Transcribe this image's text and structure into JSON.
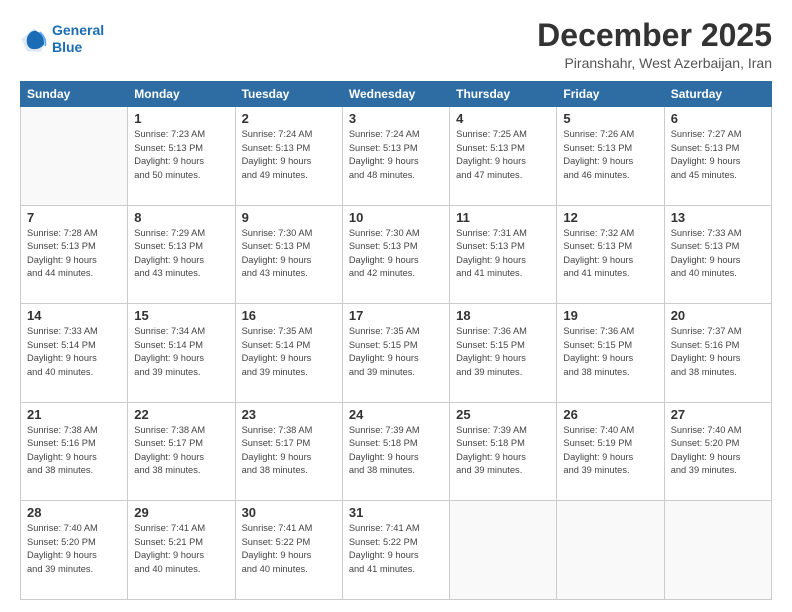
{
  "logo": {
    "line1": "General",
    "line2": "Blue"
  },
  "header": {
    "month": "December 2025",
    "location": "Piranshahr, West Azerbaijan, Iran"
  },
  "weekdays": [
    "Sunday",
    "Monday",
    "Tuesday",
    "Wednesday",
    "Thursday",
    "Friday",
    "Saturday"
  ],
  "weeks": [
    [
      {
        "day": "",
        "info": ""
      },
      {
        "day": "1",
        "info": "Sunrise: 7:23 AM\nSunset: 5:13 PM\nDaylight: 9 hours\nand 50 minutes."
      },
      {
        "day": "2",
        "info": "Sunrise: 7:24 AM\nSunset: 5:13 PM\nDaylight: 9 hours\nand 49 minutes."
      },
      {
        "day": "3",
        "info": "Sunrise: 7:24 AM\nSunset: 5:13 PM\nDaylight: 9 hours\nand 48 minutes."
      },
      {
        "day": "4",
        "info": "Sunrise: 7:25 AM\nSunset: 5:13 PM\nDaylight: 9 hours\nand 47 minutes."
      },
      {
        "day": "5",
        "info": "Sunrise: 7:26 AM\nSunset: 5:13 PM\nDaylight: 9 hours\nand 46 minutes."
      },
      {
        "day": "6",
        "info": "Sunrise: 7:27 AM\nSunset: 5:13 PM\nDaylight: 9 hours\nand 45 minutes."
      }
    ],
    [
      {
        "day": "7",
        "info": "Sunrise: 7:28 AM\nSunset: 5:13 PM\nDaylight: 9 hours\nand 44 minutes."
      },
      {
        "day": "8",
        "info": "Sunrise: 7:29 AM\nSunset: 5:13 PM\nDaylight: 9 hours\nand 43 minutes."
      },
      {
        "day": "9",
        "info": "Sunrise: 7:30 AM\nSunset: 5:13 PM\nDaylight: 9 hours\nand 43 minutes."
      },
      {
        "day": "10",
        "info": "Sunrise: 7:30 AM\nSunset: 5:13 PM\nDaylight: 9 hours\nand 42 minutes."
      },
      {
        "day": "11",
        "info": "Sunrise: 7:31 AM\nSunset: 5:13 PM\nDaylight: 9 hours\nand 41 minutes."
      },
      {
        "day": "12",
        "info": "Sunrise: 7:32 AM\nSunset: 5:13 PM\nDaylight: 9 hours\nand 41 minutes."
      },
      {
        "day": "13",
        "info": "Sunrise: 7:33 AM\nSunset: 5:13 PM\nDaylight: 9 hours\nand 40 minutes."
      }
    ],
    [
      {
        "day": "14",
        "info": "Sunrise: 7:33 AM\nSunset: 5:14 PM\nDaylight: 9 hours\nand 40 minutes."
      },
      {
        "day": "15",
        "info": "Sunrise: 7:34 AM\nSunset: 5:14 PM\nDaylight: 9 hours\nand 39 minutes."
      },
      {
        "day": "16",
        "info": "Sunrise: 7:35 AM\nSunset: 5:14 PM\nDaylight: 9 hours\nand 39 minutes."
      },
      {
        "day": "17",
        "info": "Sunrise: 7:35 AM\nSunset: 5:15 PM\nDaylight: 9 hours\nand 39 minutes."
      },
      {
        "day": "18",
        "info": "Sunrise: 7:36 AM\nSunset: 5:15 PM\nDaylight: 9 hours\nand 39 minutes."
      },
      {
        "day": "19",
        "info": "Sunrise: 7:36 AM\nSunset: 5:15 PM\nDaylight: 9 hours\nand 38 minutes."
      },
      {
        "day": "20",
        "info": "Sunrise: 7:37 AM\nSunset: 5:16 PM\nDaylight: 9 hours\nand 38 minutes."
      }
    ],
    [
      {
        "day": "21",
        "info": "Sunrise: 7:38 AM\nSunset: 5:16 PM\nDaylight: 9 hours\nand 38 minutes."
      },
      {
        "day": "22",
        "info": "Sunrise: 7:38 AM\nSunset: 5:17 PM\nDaylight: 9 hours\nand 38 minutes."
      },
      {
        "day": "23",
        "info": "Sunrise: 7:38 AM\nSunset: 5:17 PM\nDaylight: 9 hours\nand 38 minutes."
      },
      {
        "day": "24",
        "info": "Sunrise: 7:39 AM\nSunset: 5:18 PM\nDaylight: 9 hours\nand 38 minutes."
      },
      {
        "day": "25",
        "info": "Sunrise: 7:39 AM\nSunset: 5:18 PM\nDaylight: 9 hours\nand 39 minutes."
      },
      {
        "day": "26",
        "info": "Sunrise: 7:40 AM\nSunset: 5:19 PM\nDaylight: 9 hours\nand 39 minutes."
      },
      {
        "day": "27",
        "info": "Sunrise: 7:40 AM\nSunset: 5:20 PM\nDaylight: 9 hours\nand 39 minutes."
      }
    ],
    [
      {
        "day": "28",
        "info": "Sunrise: 7:40 AM\nSunset: 5:20 PM\nDaylight: 9 hours\nand 39 minutes."
      },
      {
        "day": "29",
        "info": "Sunrise: 7:41 AM\nSunset: 5:21 PM\nDaylight: 9 hours\nand 40 minutes."
      },
      {
        "day": "30",
        "info": "Sunrise: 7:41 AM\nSunset: 5:22 PM\nDaylight: 9 hours\nand 40 minutes."
      },
      {
        "day": "31",
        "info": "Sunrise: 7:41 AM\nSunset: 5:22 PM\nDaylight: 9 hours\nand 41 minutes."
      },
      {
        "day": "",
        "info": ""
      },
      {
        "day": "",
        "info": ""
      },
      {
        "day": "",
        "info": ""
      }
    ]
  ]
}
